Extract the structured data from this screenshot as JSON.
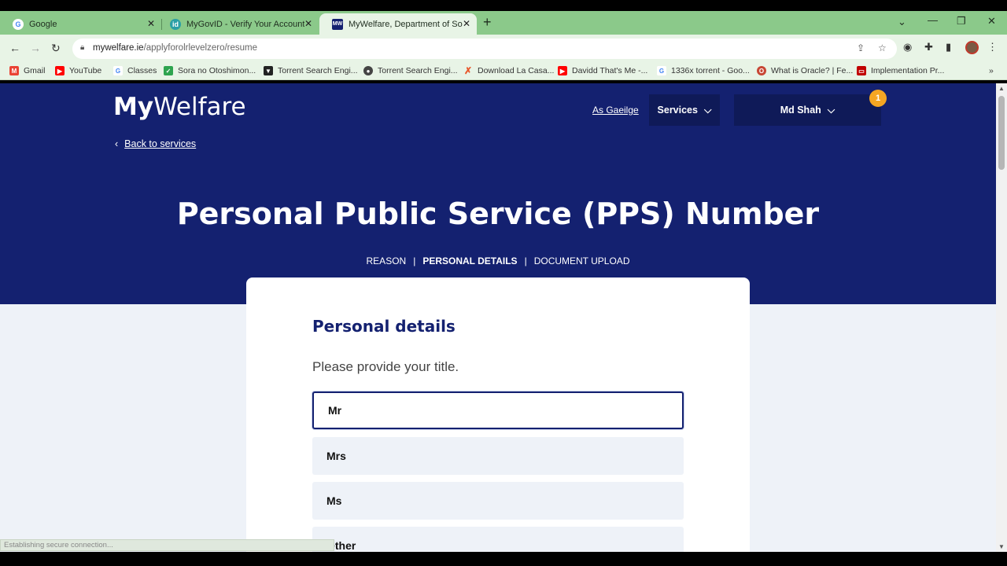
{
  "browser": {
    "tabs": [
      {
        "title": "Google",
        "icon": "google-icon"
      },
      {
        "title": "MyGovID - Verify Your Account",
        "icon": "mygovid-icon"
      },
      {
        "title": "MyWelfare, Department of Social",
        "icon": "mywelfare-icon"
      }
    ],
    "url_host": "mywelfare.ie",
    "url_path": "/applyforolrlevelzero/resume",
    "bookmarks": [
      {
        "label": "Gmail",
        "color": "#ea4335"
      },
      {
        "label": "YouTube",
        "color": "#ff0000"
      },
      {
        "label": "Classes",
        "color": "#4285f4"
      },
      {
        "label": "Sora no Otoshimon...",
        "color": "#2ea44f"
      },
      {
        "label": "Torrent Search Engi...",
        "color": "#222222"
      },
      {
        "label": "Torrent Search Engi...",
        "color": "#444444"
      },
      {
        "label": "Download La Casa...",
        "color": "#e8572a"
      },
      {
        "label": "Davidd That's Me -...",
        "color": "#ff0000"
      },
      {
        "label": "1336x torrent - Goo...",
        "color": "#4285f4"
      },
      {
        "label": "What is Oracle? | Fe...",
        "color": "#c74634"
      },
      {
        "label": "Implementation Pr...",
        "color": "#c00000"
      }
    ],
    "status_text": "Establishing secure connection..."
  },
  "site": {
    "logo_bold": "My",
    "logo_rest": "Welfare",
    "language_link": "As Gaeilge",
    "services_label": "Services",
    "user_name": "Md Shah",
    "notification_count": "1",
    "back_link": "Back to services"
  },
  "page": {
    "title": "Personal Public Service (PPS) Number",
    "steps": [
      "REASON",
      "PERSONAL DETAILS",
      "DOCUMENT UPLOAD"
    ],
    "current_step": "PERSONAL DETAILS"
  },
  "form": {
    "heading": "Personal details",
    "question": "Please provide your title.",
    "options": [
      "Mr",
      "Mrs",
      "Ms",
      "Other"
    ],
    "selected": "Mr"
  },
  "colors": {
    "brand_navy": "#142170",
    "badge_orange": "#f5a623",
    "browser_green": "#8bc98a"
  }
}
